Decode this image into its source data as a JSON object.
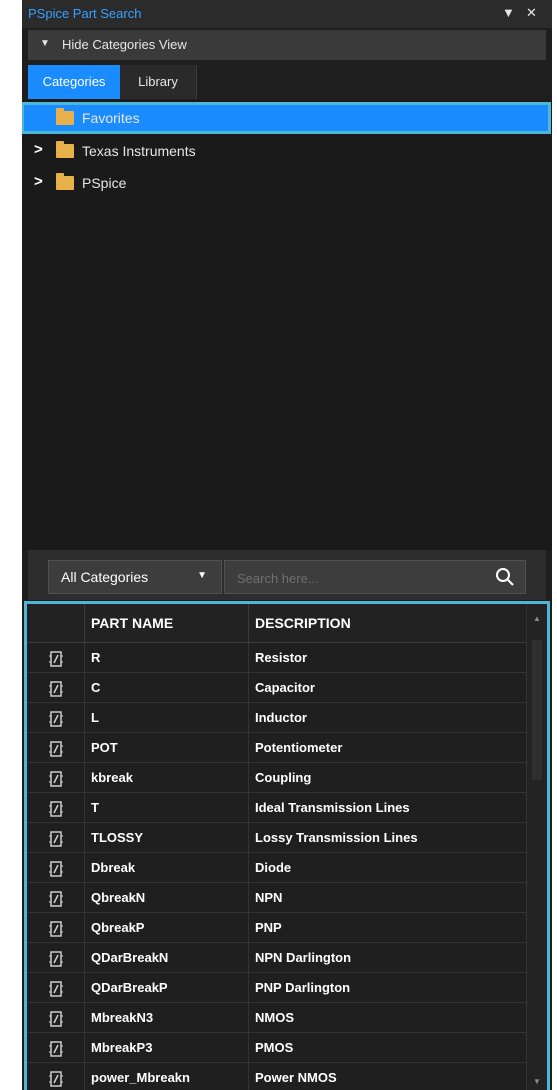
{
  "window": {
    "title": "PSpice Part Search",
    "menu_icon": "chevron-down-icon",
    "close_icon": "close-icon"
  },
  "toggle": {
    "label": "Hide Categories View"
  },
  "tabs": [
    {
      "label": "Categories",
      "active": true
    },
    {
      "label": "Library",
      "active": false
    }
  ],
  "tree": {
    "items": [
      {
        "label": "Favorites",
        "expandable": false,
        "selected": true
      },
      {
        "label": "Texas Instruments",
        "expandable": true,
        "selected": false
      },
      {
        "label": "PSpice",
        "expandable": true,
        "selected": false
      }
    ]
  },
  "filter": {
    "category": "All Categories",
    "search_placeholder": "Search here..."
  },
  "table": {
    "columns": [
      "PART NAME",
      "DESCRIPTION"
    ],
    "rows": [
      {
        "name": "R",
        "description": "Resistor"
      },
      {
        "name": "C",
        "description": "Capacitor"
      },
      {
        "name": "L",
        "description": "Inductor"
      },
      {
        "name": "POT",
        "description": "Potentiometer"
      },
      {
        "name": "kbreak",
        "description": "Coupling"
      },
      {
        "name": "T",
        "description": "Ideal Transmission Lines"
      },
      {
        "name": "TLOSSY",
        "description": "Lossy Transmission Lines"
      },
      {
        "name": "Dbreak",
        "description": "Diode"
      },
      {
        "name": "QbreakN",
        "description": "NPN"
      },
      {
        "name": "QbreakP",
        "description": "PNP"
      },
      {
        "name": "QDarBreakN",
        "description": "NPN Darlington"
      },
      {
        "name": "QDarBreakP",
        "description": "PNP Darlington"
      },
      {
        "name": "MbreakN3",
        "description": "NMOS"
      },
      {
        "name": "MbreakP3",
        "description": "PMOS"
      },
      {
        "name": "power_Mbreakn",
        "description": "Power NMOS"
      }
    ]
  },
  "colors": {
    "accent": "#1a8cff",
    "highlight_border": "#4fb6d6",
    "folder": "#e8b04a",
    "title": "#3aa0ff"
  }
}
